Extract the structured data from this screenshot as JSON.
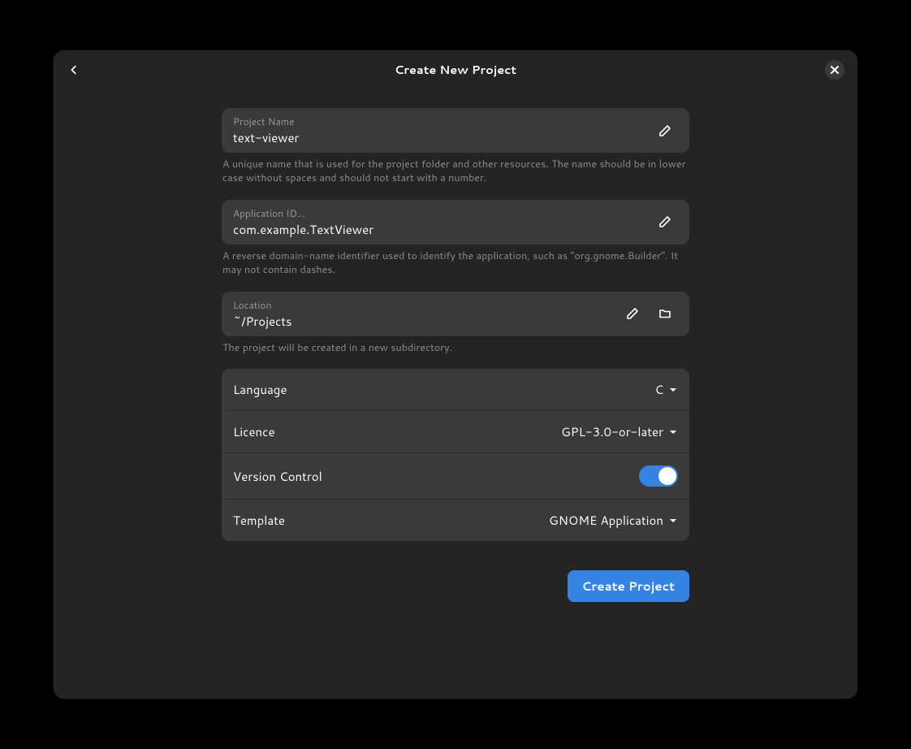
{
  "header": {
    "title": "Create New Project"
  },
  "fields": {
    "project_name": {
      "label": "Project Name",
      "value": "text-viewer",
      "help": "A unique name that is used for the project folder and other resources. The name should be in lower case without spaces and should not start with a number."
    },
    "application_id": {
      "label": "Application ID…",
      "value": "com.example.TextViewer",
      "help": "A reverse domain-name identifier used to identify the application, such as \"org.gnome.Builder\". It may not contain dashes."
    },
    "location": {
      "label": "Location",
      "value": "~/Projects",
      "help": "The project will be created in a new subdirectory."
    }
  },
  "options": {
    "language": {
      "label": "Language",
      "value": "C"
    },
    "licence": {
      "label": "Licence",
      "value": "GPL-3.0-or-later"
    },
    "version_control": {
      "label": "Version Control",
      "enabled": true
    },
    "template": {
      "label": "Template",
      "value": "GNOME Application"
    }
  },
  "actions": {
    "create": "Create Project"
  }
}
